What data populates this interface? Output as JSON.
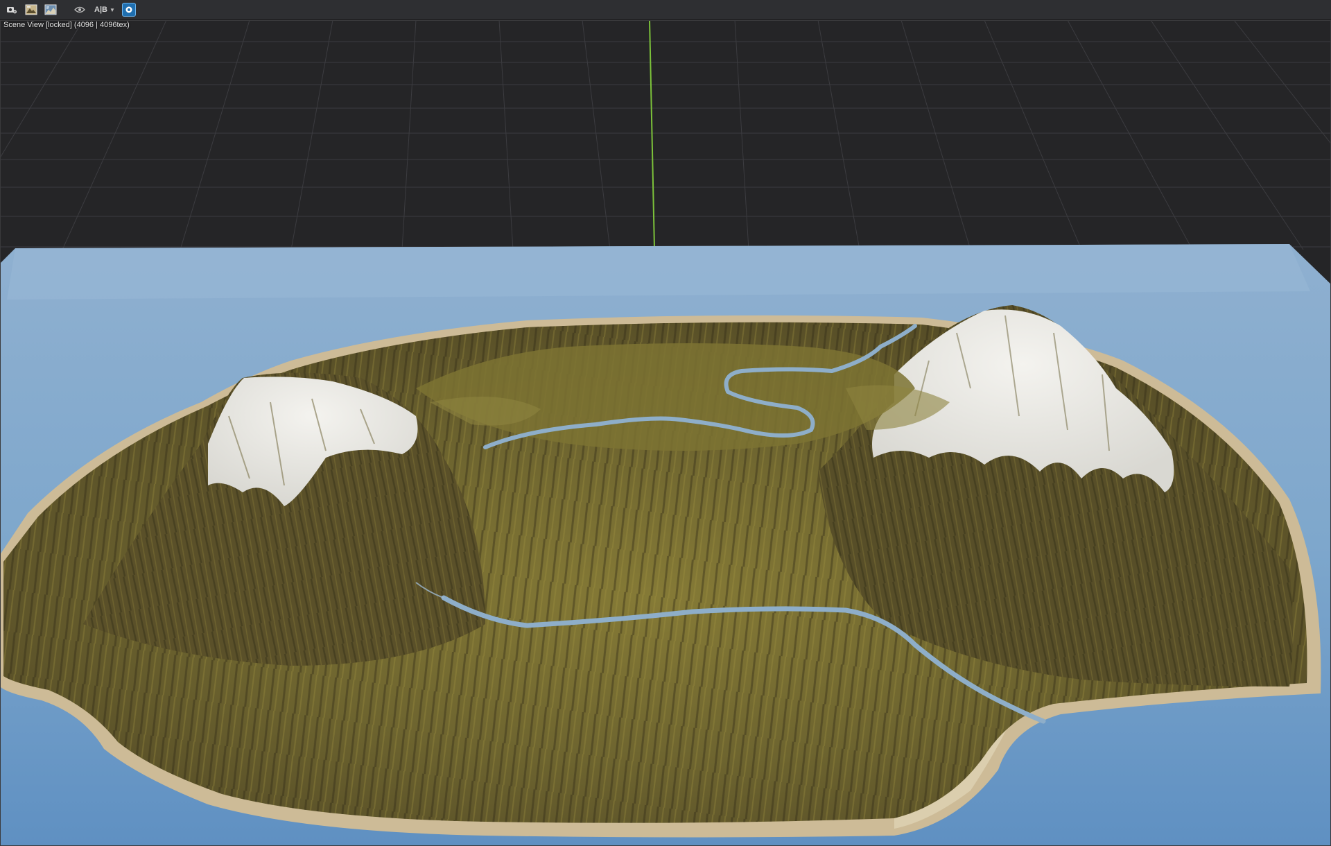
{
  "toolbar": {
    "buttons": [
      {
        "name": "view-settings",
        "icon": "camera-gear-icon"
      },
      {
        "name": "render-image",
        "icon": "image-icon"
      },
      {
        "name": "render-chart",
        "icon": "graph-image-icon"
      },
      {
        "name": "visibility",
        "icon": "eye-icon"
      }
    ],
    "ab_toggle_label": "A|B",
    "active_toggle_icon": "gear-blue-icon"
  },
  "viewport": {
    "label": "Scene View [locked] (4096 | 4096tex)"
  },
  "colors": {
    "background": "#252527",
    "grid": "#3c3c40",
    "axis_green": "#7cc23a",
    "water": "#7aa4c8",
    "snow": "#ecebe6",
    "terrain_light": "#8f8233",
    "terrain_dark": "#4b4526",
    "sand": "#cdbb97",
    "river": "#8eaec9",
    "accent_blue": "#1f6fb0"
  }
}
